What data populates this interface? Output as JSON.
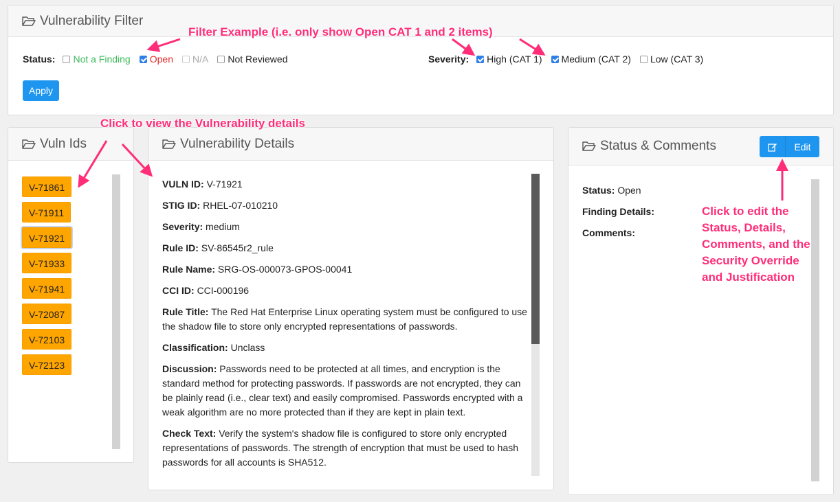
{
  "filter": {
    "title": "Vulnerability Filter",
    "status_label": "Status:",
    "status_options": [
      {
        "label": "Not a Finding",
        "checked": false,
        "color": "#3cb95a"
      },
      {
        "label": "Open",
        "checked": true,
        "color": "#e02a2a"
      },
      {
        "label": "N/A",
        "checked": false,
        "color": "#aaaaaa"
      },
      {
        "label": "Not Reviewed",
        "checked": false,
        "color": "#222222"
      }
    ],
    "severity_label": "Severity:",
    "severity_options": [
      {
        "label": "High (CAT 1)",
        "checked": true
      },
      {
        "label": "Medium (CAT 2)",
        "checked": true
      },
      {
        "label": "Low (CAT 3)",
        "checked": false
      }
    ],
    "apply_label": "Apply"
  },
  "vuln_ids": {
    "title": "Vuln Ids",
    "items": [
      "V-71861",
      "V-71911",
      "V-71921",
      "V-71933",
      "V-71941",
      "V-72087",
      "V-72103",
      "V-72123"
    ],
    "selected": "V-71921"
  },
  "details": {
    "title": "Vulnerability Details",
    "rows": [
      {
        "label": "VULN ID:",
        "value": "V-71921"
      },
      {
        "label": "STIG ID:",
        "value": "RHEL-07-010210"
      },
      {
        "label": "Severity:",
        "value": "medium"
      },
      {
        "label": "Rule ID:",
        "value": "SV-86545r2_rule"
      },
      {
        "label": "Rule Name:",
        "value": "SRG-OS-000073-GPOS-00041"
      },
      {
        "label": "CCI ID:",
        "value": "CCI-000196"
      },
      {
        "label": "Rule Title:",
        "value": "The Red Hat Enterprise Linux operating system must be configured to use the shadow file to store only encrypted representations of passwords."
      },
      {
        "label": "Classification:",
        "value": "Unclass"
      },
      {
        "label": "Discussion:",
        "value": "Passwords need to be protected at all times, and encryption is the standard method for protecting passwords. If passwords are not encrypted, they can be plainly read (i.e., clear text) and easily compromised. Passwords encrypted with a weak algorithm are no more protected than if they are kept in plain text."
      },
      {
        "label": "Check Text:",
        "value": "Verify the system's shadow file is configured to store only encrypted representations of passwords. The strength of encryption that must be used to hash passwords for all accounts is SHA512."
      }
    ]
  },
  "status_panel": {
    "title": "Status & Comments",
    "edit_label": "Edit",
    "status_label": "Status:",
    "status_value": "Open",
    "finding_label": "Finding Details:",
    "comments_label": "Comments:"
  },
  "annotations": {
    "filter": "Filter Example (i.e. only show Open CAT 1 and 2 items)",
    "vuln": "Click to view the Vulnerability details",
    "edit_lines": [
      "Click to edit the",
      "Status, Details,",
      "Comments, and the",
      "Security Override",
      "and Justification"
    ]
  },
  "colors": {
    "accent": "#1e96f0",
    "vuln_badge": "#ffa500",
    "annotation": "#ff2d78"
  }
}
